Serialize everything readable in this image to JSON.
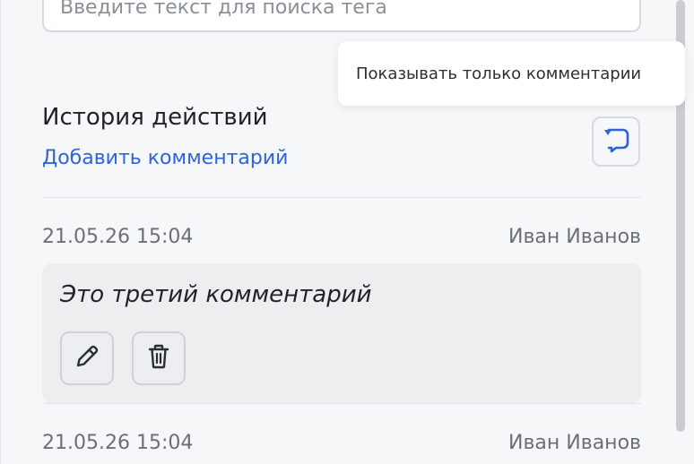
{
  "search": {
    "placeholder": "Введите текст для поиска тега"
  },
  "tooltip": {
    "text": "Показывать только комментарии"
  },
  "history": {
    "title": "История действий",
    "add_comment_label": "Добавить комментарий"
  },
  "entries": [
    {
      "timestamp": "21.05.26 15:04",
      "author": "Иван Иванов",
      "comment": "Это третий комментарий"
    },
    {
      "timestamp": "21.05.26 15:04",
      "author": "Иван Иванов"
    }
  ],
  "icons": {
    "filter": "comment-filter-icon",
    "edit": "pencil-icon",
    "delete": "trash-icon"
  },
  "colors": {
    "link": "#2f64d6",
    "panel_background": "#f6f7f8",
    "comment_background": "#eceef0",
    "border": "#d6d9de"
  }
}
